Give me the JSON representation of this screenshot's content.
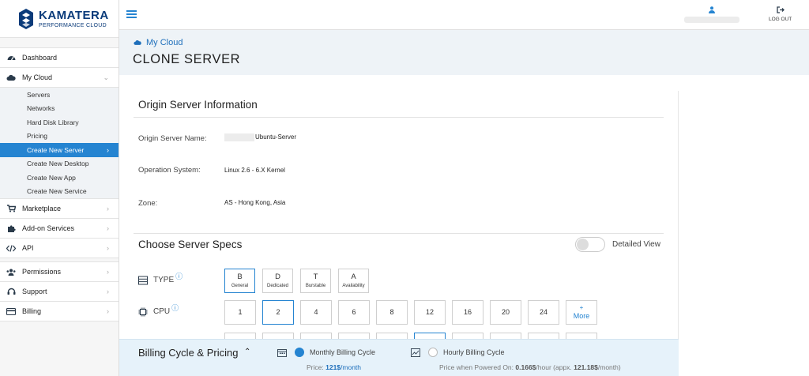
{
  "brand": {
    "name": "KAMATERA",
    "tagline": "PERFORMANCE CLOUD",
    "color": "#0b3b7a"
  },
  "accent": "#2584d1",
  "topbar": {
    "logout_label": "LOG OUT"
  },
  "sidebar": {
    "items": [
      {
        "label": "Dashboard",
        "icon": "dashboard-icon"
      },
      {
        "label": "My Cloud",
        "icon": "cloud-icon",
        "expanded": true,
        "children": [
          {
            "label": "Servers"
          },
          {
            "label": "Networks"
          },
          {
            "label": "Hard Disk Library"
          },
          {
            "label": "Pricing"
          },
          {
            "label": "Create New Server",
            "active": true
          },
          {
            "label": "Create New Desktop"
          },
          {
            "label": "Create New App"
          },
          {
            "label": "Create New Service"
          }
        ]
      },
      {
        "label": "Marketplace",
        "icon": "cart-icon"
      },
      {
        "label": "Add-on Services",
        "icon": "puzzle-icon"
      },
      {
        "label": "API",
        "icon": "code-icon"
      },
      {
        "label": "Permissions",
        "icon": "users-icon"
      },
      {
        "label": "Support",
        "icon": "headset-icon"
      },
      {
        "label": "Billing",
        "icon": "credit-card-icon"
      }
    ]
  },
  "header": {
    "breadcrumb": "My Cloud",
    "title": "CLONE SERVER"
  },
  "origin": {
    "title": "Origin Server Information",
    "server_name_label": "Origin Server Name:",
    "server_name_value": "Ubuntu-Server",
    "os_label": "Operation System:",
    "os_value": "Linux 2.6 - 6.X Kernel",
    "zone_label": "Zone:",
    "zone_value": "AS - Hong Kong, Asia"
  },
  "specs": {
    "title": "Choose Server Specs",
    "detailed_view_label": "Detailed View",
    "detailed_view_on": false,
    "type_label": "TYPE",
    "types": [
      {
        "letter": "B",
        "name": "General",
        "selected": true
      },
      {
        "letter": "D",
        "name": "Dedicated"
      },
      {
        "letter": "T",
        "name": "Burstable"
      },
      {
        "letter": "A",
        "name": "Availability"
      }
    ],
    "cpu_label": "CPU",
    "cpus": [
      "1",
      "2",
      "4",
      "6",
      "8",
      "12",
      "16",
      "20",
      "24"
    ],
    "cpu_selected": "2",
    "more_symbol": "+",
    "more_label": "More"
  },
  "billing": {
    "title": "Billing Cycle & Pricing",
    "monthly_label": "Monthly Billing Cycle",
    "monthly_price_prefix": "Price:",
    "monthly_price": "121$",
    "monthly_unit": "/month",
    "hourly_label": "Hourly Billing Cycle",
    "hourly_price_prefix": "Price when Powered On:",
    "hourly_price": "0.166$",
    "hourly_unit": "/hour (appx.",
    "hourly_monthly": "121.18$",
    "hourly_monthly_unit": "/month)"
  }
}
